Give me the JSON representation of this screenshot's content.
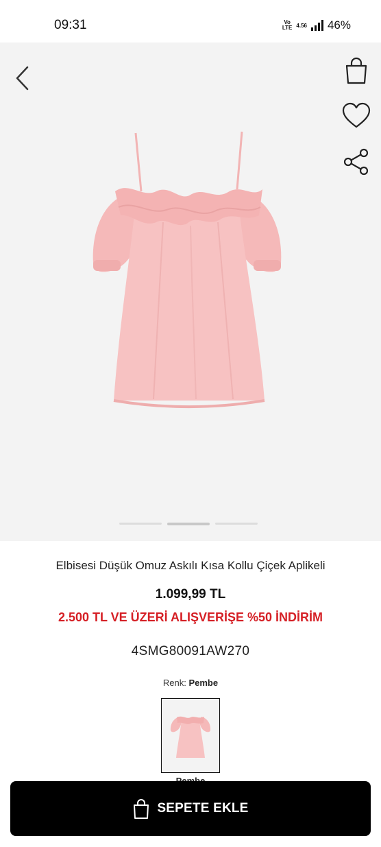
{
  "status": {
    "time": "09:31",
    "network": "Vo LTE",
    "net_speed": "4.56",
    "battery": "46%"
  },
  "product": {
    "title": "Elbisesi Düşük Omuz Askılı Kısa Kollu Çiçek Aplikeli",
    "price": "1.099,99 TL",
    "promo": "2.500 TL VE ÜZERİ ALIŞVERİŞE %50 İNDİRİM",
    "sku": "4SMG80091AW270",
    "color_label": "Renk:",
    "color_value": "Pembe",
    "swatch_label": "Pembe",
    "dress_color": "#f7c2c2"
  },
  "gallery": {
    "image_count": 3,
    "active_index": 1
  },
  "actions": {
    "add_to_cart": "SEPETE EKLE"
  },
  "icons": {
    "back": "chevron-left-icon",
    "bag": "shopping-bag-icon",
    "favorite": "heart-icon",
    "share": "share-icon"
  }
}
